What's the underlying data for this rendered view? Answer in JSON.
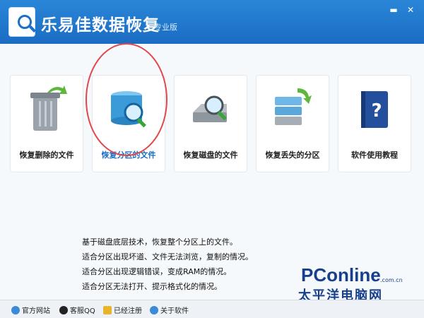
{
  "window": {
    "title": "乐易佳数据恢复",
    "edition": "专业版",
    "minimize_icon": "minimize-icon",
    "close_icon": "close-icon"
  },
  "tiles": [
    {
      "label": "恢复删除的文件",
      "icon": "trash-restore-icon"
    },
    {
      "label": "恢复分区的文件",
      "icon": "partition-search-icon",
      "selected": true
    },
    {
      "label": "恢复磁盘的文件",
      "icon": "disk-search-icon"
    },
    {
      "label": "恢复丢失的分区",
      "icon": "server-recover-icon"
    },
    {
      "label": "软件使用教程",
      "icon": "help-book-icon"
    }
  ],
  "description": [
    "基于磁盘底层技术，恢复整个分区上的文件。",
    "适合分区出现坏道、文件无法浏览，复制的情况。",
    "适合分区出现逻辑错误，变成RAM的情况。",
    "适合分区无法打开、提示格式化的情况。"
  ],
  "footer": {
    "website": "官方网站",
    "qq": "客服QQ",
    "registered": "已经注册",
    "about": "关于软件"
  },
  "watermark": {
    "brand": "PConline",
    "domain": ".com.cn",
    "chinese": "太平洋电脑网"
  },
  "colors": {
    "titlebar": "#1a6cc2",
    "accent": "#1a6cc2",
    "highlight": "#e2474b",
    "watermark": "#183f8c"
  }
}
